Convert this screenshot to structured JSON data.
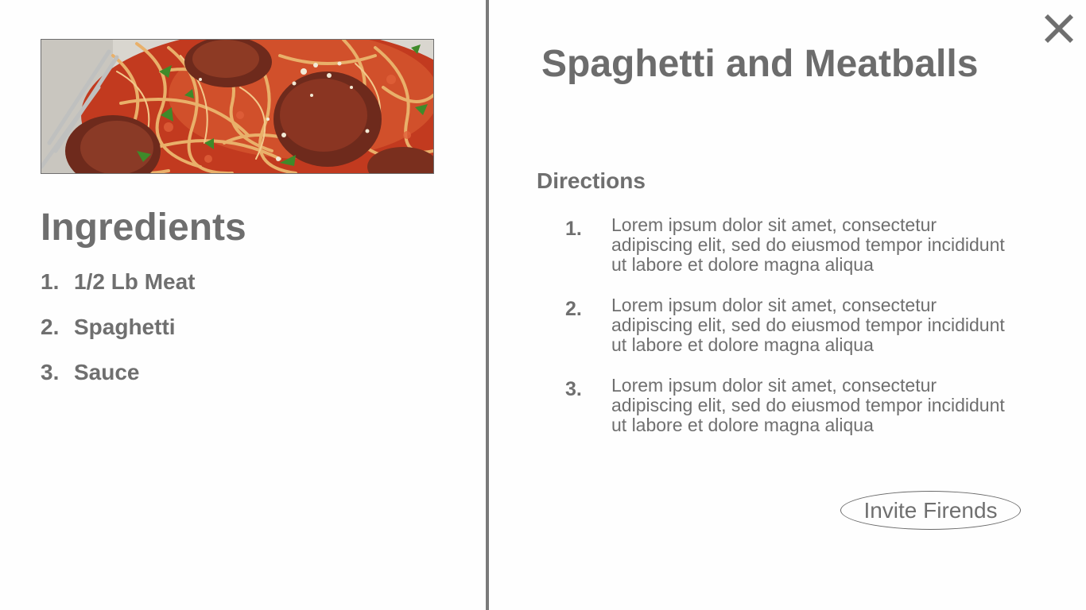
{
  "recipe": {
    "title": "Spaghetti and Meatballs",
    "image_alt": "Spaghetti and Meatballs"
  },
  "ingredients": {
    "title": "Ingredients",
    "items": [
      {
        "num": "1.",
        "label": "1/2 Lb Meat"
      },
      {
        "num": "2.",
        "label": "Spaghetti"
      },
      {
        "num": "3.",
        "label": "Sauce"
      }
    ]
  },
  "directions": {
    "title": "Directions",
    "steps": [
      {
        "num": "1.",
        "text": "Lorem ipsum dolor sit amet, consectetur adipiscing elit, sed do eiusmod tempor incididunt ut labore et dolore magna aliqua"
      },
      {
        "num": "2.",
        "text": "Lorem ipsum dolor sit amet, consectetur adipiscing elit, sed do eiusmod tempor incididunt ut labore et dolore magna aliqua"
      },
      {
        "num": "3.",
        "text": "Lorem ipsum dolor sit amet, consectetur adipiscing elit, sed do eiusmod tempor incididunt ut labore et dolore magna aliqua"
      }
    ]
  },
  "actions": {
    "invite_label": "Invite Firends",
    "close_icon": "close-icon"
  },
  "colors": {
    "text": "#6f6f6f",
    "divider": "#7a7a7a",
    "background": "#fefefe",
    "sauce": "#c8351f",
    "meatball": "#7a2e1f",
    "pasta": "#e6a860",
    "herb": "#3f8a2a"
  }
}
